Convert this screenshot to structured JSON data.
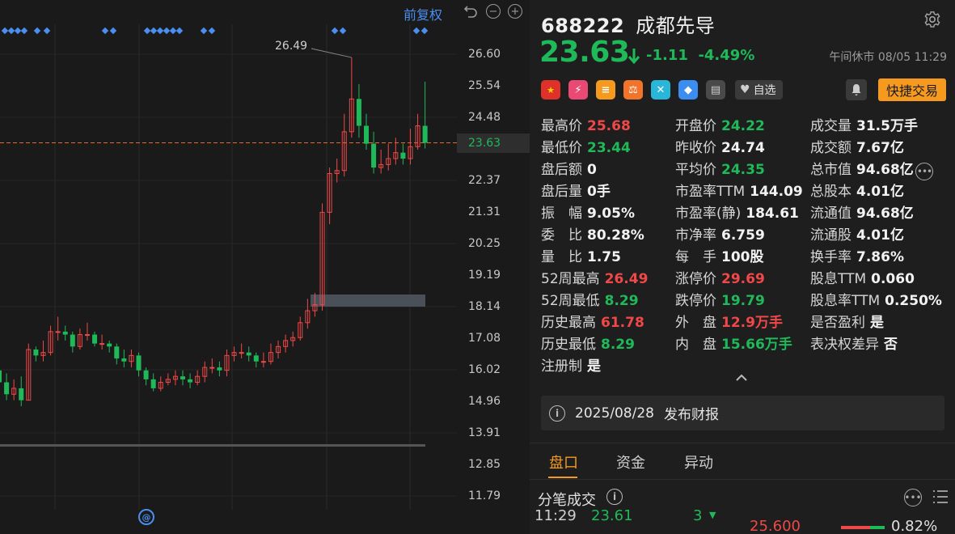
{
  "chart": {
    "adjust_label": "前复权",
    "peak_label": "26.49",
    "price_ticks": [
      "26.60",
      "25.54",
      "24.48",
      "23.63",
      "22.37",
      "21.31",
      "20.25",
      "19.19",
      "18.14",
      "17.08",
      "16.02",
      "14.96",
      "13.91",
      "12.85",
      "11.79"
    ],
    "current_price": "23.63",
    "colors": {
      "up": "#f04848",
      "down": "#1fb95a",
      "ref_line": "#e0702a",
      "marker": "#4a8ef0",
      "box": "#4a5058"
    },
    "icons": [
      "undo-icon",
      "zoom-out-icon",
      "zoom-in-icon",
      "zoom-magnifier-icon"
    ]
  },
  "chart_data": {
    "type": "candlestick",
    "x": [
      "d1",
      "d2",
      "d3",
      "d4",
      "d5",
      "d6",
      "d7",
      "d8",
      "d9",
      "d10",
      "d11",
      "d12",
      "d13",
      "d14",
      "d15",
      "d16",
      "d17",
      "d18",
      "d19",
      "d20",
      "d21",
      "d22",
      "d23",
      "d24",
      "d25",
      "d26",
      "d27",
      "d28",
      "d29",
      "d30",
      "d31",
      "d32",
      "d33",
      "d34",
      "d35",
      "d36",
      "d37",
      "d38",
      "d39",
      "d40",
      "d41",
      "d42",
      "d43",
      "d44",
      "d45",
      "d46",
      "d47",
      "d48",
      "d49",
      "d50",
      "d51",
      "d52",
      "d53",
      "d54"
    ],
    "series": [
      {
        "open": [
          16.0,
          15.6,
          15.2,
          15.4,
          15.0,
          16.7,
          16.5,
          16.6,
          17.3,
          17.3,
          17.2,
          16.8,
          17.2,
          17.2,
          16.9,
          16.9,
          16.8,
          16.4,
          16.3,
          16.5,
          16.0,
          15.7,
          15.4,
          15.6,
          15.7,
          15.8,
          15.7,
          15.6,
          15.8,
          16.1,
          16.1,
          16.0,
          16.5,
          16.6,
          16.6,
          16.5,
          16.3,
          16.3,
          16.6,
          16.8,
          17.0,
          17.1,
          17.6,
          18.0,
          18.2,
          21.3,
          22.6,
          22.7,
          24.0,
          25.1,
          24.2,
          23.6,
          22.8,
          22.9,
          23.1,
          23.3,
          23.1,
          23.5,
          24.2
        ],
        "close": [
          15.6,
          15.2,
          15.4,
          15.0,
          16.7,
          16.5,
          16.6,
          17.3,
          17.3,
          17.2,
          16.8,
          17.2,
          17.2,
          16.9,
          16.9,
          16.8,
          16.4,
          16.3,
          16.5,
          16.0,
          15.7,
          15.4,
          15.6,
          15.7,
          15.8,
          15.7,
          15.6,
          15.8,
          16.1,
          16.1,
          16.0,
          16.5,
          16.6,
          16.6,
          16.5,
          16.3,
          16.3,
          16.6,
          16.8,
          17.0,
          17.1,
          17.6,
          18.0,
          18.2,
          21.3,
          22.6,
          22.7,
          24.0,
          25.1,
          24.2,
          23.6,
          22.8,
          22.9,
          23.1,
          23.3,
          23.1,
          23.5,
          24.2,
          23.63
        ],
        "high": [
          16.3,
          15.9,
          15.7,
          15.8,
          16.9,
          16.8,
          17.0,
          17.5,
          17.8,
          17.5,
          17.3,
          17.4,
          17.6,
          17.3,
          17.2,
          17.0,
          16.9,
          16.7,
          16.7,
          16.6,
          16.1,
          15.9,
          15.8,
          15.9,
          16.0,
          16.0,
          15.9,
          16.0,
          16.3,
          16.4,
          16.3,
          16.7,
          16.8,
          16.9,
          16.8,
          16.6,
          16.6,
          16.9,
          17.0,
          17.2,
          17.3,
          17.8,
          18.4,
          18.6,
          21.6,
          22.8,
          23.1,
          24.6,
          26.49,
          25.6,
          24.6,
          24.0,
          23.4,
          23.6,
          23.8,
          23.6,
          24.1,
          24.6,
          25.68
        ],
        "low": [
          15.4,
          15.0,
          15.0,
          14.8,
          15.0,
          16.3,
          16.3,
          16.5,
          17.0,
          17.0,
          16.6,
          16.7,
          17.0,
          16.8,
          16.7,
          16.6,
          16.2,
          16.1,
          16.1,
          15.8,
          15.5,
          15.3,
          15.3,
          15.5,
          15.5,
          15.5,
          15.4,
          15.5,
          15.6,
          15.9,
          15.8,
          15.8,
          16.3,
          16.4,
          16.3,
          16.1,
          16.1,
          16.2,
          16.4,
          16.6,
          16.8,
          17.0,
          17.4,
          17.8,
          18.0,
          20.9,
          22.3,
          22.5,
          23.8,
          23.8,
          23.4,
          22.6,
          22.6,
          22.7,
          22.9,
          22.9,
          22.9,
          23.4,
          23.44
        ]
      }
    ],
    "ylim": [
      11.79,
      27.0
    ],
    "annotations": [
      {
        "text": "26.49"
      }
    ],
    "reference_line": 23.63
  },
  "quote": {
    "code": "688222",
    "name": "成都先导",
    "price": "23.63",
    "change": "-1.11",
    "change_pct": "-4.49%",
    "status": "午间休市 08/05 11:29",
    "fav_label": "自选",
    "quick_trade_label": "快捷交易",
    "badge_icons": [
      "china-flag-icon",
      "margin-icon",
      "data-icon",
      "scale-icon",
      "connect-icon",
      "tag-icon",
      "doc-icon"
    ]
  },
  "stats": {
    "col1": [
      {
        "label": "最高价",
        "value": "25.68",
        "tone": "red"
      },
      {
        "label": "最低价",
        "value": "23.44",
        "tone": "green"
      },
      {
        "label": "盘后额",
        "value": "0",
        "tone": "white"
      },
      {
        "label": "盘后量",
        "value": "0手",
        "tone": "white"
      },
      {
        "label": "振　幅",
        "value": "9.05%",
        "tone": "white"
      },
      {
        "label": "委　比",
        "value": "80.28%",
        "tone": "white"
      },
      {
        "label": "量　比",
        "value": "1.75",
        "tone": "white"
      },
      {
        "label": "52周最高",
        "value": "26.49",
        "tone": "red"
      },
      {
        "label": "52周最低",
        "value": "8.29",
        "tone": "green"
      },
      {
        "label": "历史最高",
        "value": "61.78",
        "tone": "red"
      },
      {
        "label": "历史最低",
        "value": "8.29",
        "tone": "green"
      },
      {
        "label": "注册制",
        "value": "是",
        "tone": "white"
      }
    ],
    "col2": [
      {
        "label": "开盘价",
        "value": "24.22",
        "tone": "green"
      },
      {
        "label": "昨收价",
        "value": "24.74",
        "tone": "white"
      },
      {
        "label": "平均价",
        "value": "24.35",
        "tone": "green"
      },
      {
        "label": "市盈率TTM",
        "value": "144.09",
        "tone": "white"
      },
      {
        "label": "市盈率(静)",
        "value": "184.61",
        "tone": "white"
      },
      {
        "label": "市净率",
        "value": "6.759",
        "tone": "white"
      },
      {
        "label": "每　手",
        "value": "100股",
        "tone": "white"
      },
      {
        "label": "涨停价",
        "value": "29.69",
        "tone": "red"
      },
      {
        "label": "跌停价",
        "value": "19.79",
        "tone": "green"
      },
      {
        "label": "外　盘",
        "value": "12.9万手",
        "tone": "red"
      },
      {
        "label": "内　盘",
        "value": "15.66万手",
        "tone": "green"
      }
    ],
    "col3": [
      {
        "label": "成交量",
        "value": "31.5万手",
        "tone": "white"
      },
      {
        "label": "成交额",
        "value": "7.67亿",
        "tone": "white"
      },
      {
        "label": "总市值",
        "value": "94.68亿",
        "tone": "white"
      },
      {
        "label": "总股本",
        "value": "4.01亿",
        "tone": "white"
      },
      {
        "label": "流通值",
        "value": "94.68亿",
        "tone": "white"
      },
      {
        "label": "流通股",
        "value": "4.01亿",
        "tone": "white"
      },
      {
        "label": "换手率",
        "value": "7.86%",
        "tone": "white"
      },
      {
        "label": "股息TTM",
        "value": "0.060",
        "tone": "white"
      },
      {
        "label": "股息率TTM",
        "value": "0.250%",
        "tone": "white"
      },
      {
        "label": "是否盈利",
        "value": "是",
        "tone": "white"
      },
      {
        "label": "表决权差异",
        "value": "否",
        "tone": "white"
      }
    ]
  },
  "report": {
    "date": "2025/08/28",
    "label": "发布财报"
  },
  "tabs": [
    {
      "label": "盘口",
      "active": true
    },
    {
      "label": "资金",
      "active": false
    },
    {
      "label": "异动",
      "active": false
    }
  ],
  "ticks_section": {
    "title": "分笔成交",
    "row": {
      "time": "11:29",
      "price": "23.61",
      "vol": "3",
      "level_price": "25.600",
      "level_pct": "0.82%"
    }
  }
}
